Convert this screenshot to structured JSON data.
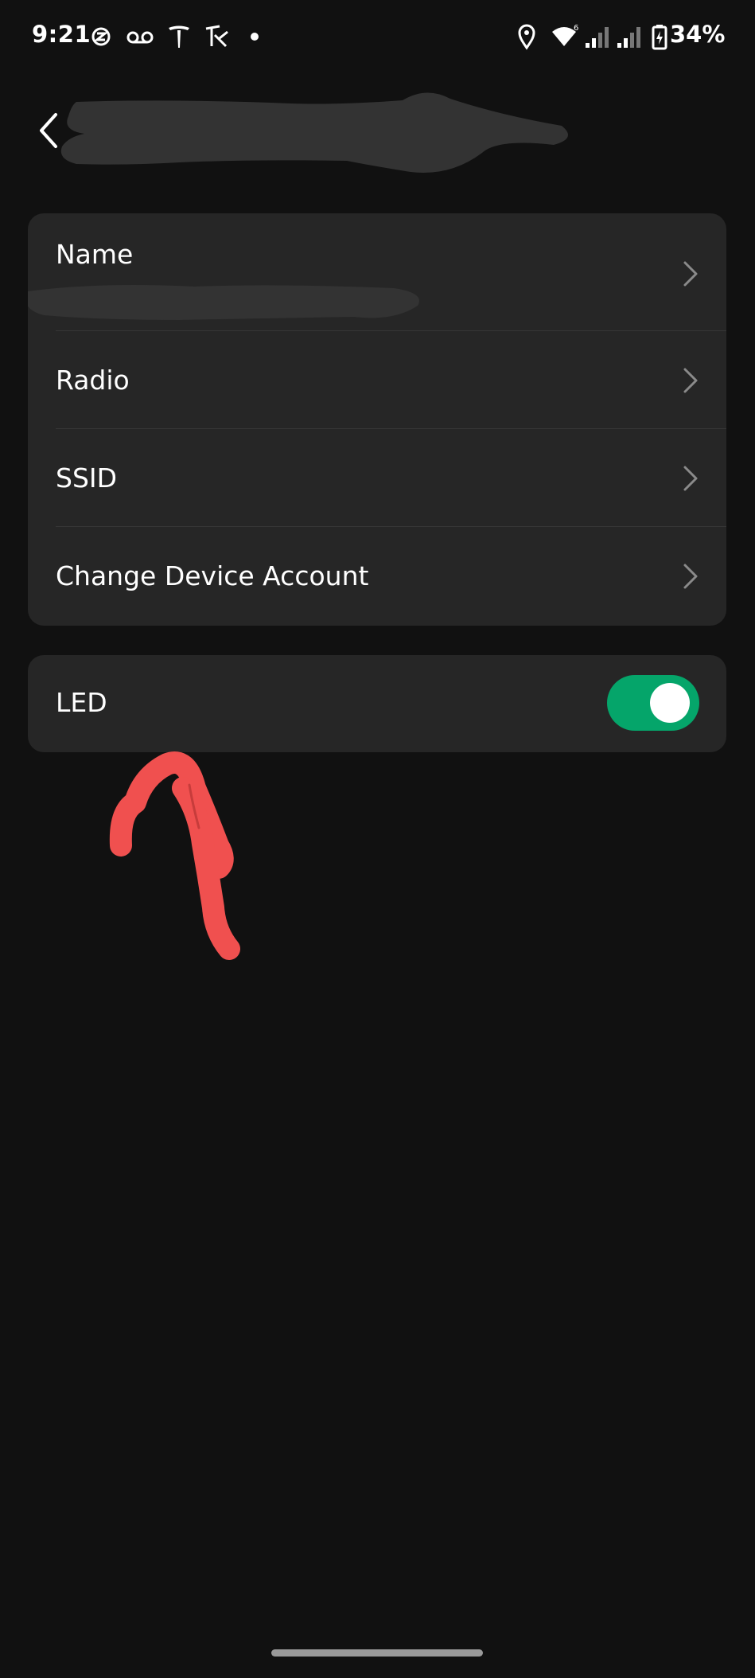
{
  "status_bar": {
    "time": "9:21",
    "battery": "34%",
    "icons": [
      "sync-icon",
      "voicemail-icon",
      "tesla-icon",
      "app-icon",
      "dot-icon",
      "location-icon",
      "wifi-icon",
      "signal-icon",
      "signal-icon-2",
      "battery-icon"
    ]
  },
  "header": {
    "back_icon": "chevron-left-icon"
  },
  "settings": {
    "rows": [
      {
        "label": "Name"
      },
      {
        "label": "Radio"
      },
      {
        "label": "SSID"
      },
      {
        "label": "Change Device Account"
      }
    ]
  },
  "led": {
    "label": "LED",
    "enabled": true
  },
  "colors": {
    "background": "#111111",
    "card": "#262626",
    "toggle_on": "#05A56A",
    "annotation": "#F0504F",
    "redaction": "#333333"
  }
}
